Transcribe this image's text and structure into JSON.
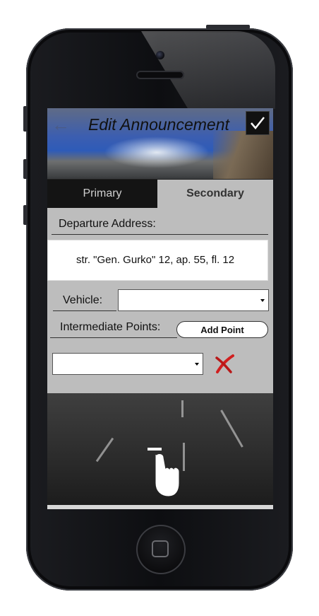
{
  "header": {
    "title": "Edit Announcement",
    "back_icon": "arrow-left-icon",
    "confirm_icon": "checkmark-icon"
  },
  "tabs": [
    {
      "label": "Primary",
      "active": false
    },
    {
      "label": "Secondary",
      "active": true
    }
  ],
  "form": {
    "departure_label": "Departure Address:",
    "departure_value": "str. \"Gen. Gurko\" 12, ap. 55, fl. 12",
    "vehicle_label": "Vehicle:",
    "vehicle_value": "",
    "intermediate_label": "Intermediate Points:",
    "add_point_label": "Add Point",
    "point_value": "",
    "delete_icon": "red-x-icon"
  },
  "colors": {
    "panel_bg": "#bdbdbd",
    "active_tab_bg": "#bdbdbd",
    "inactive_tab_bg": "#141414",
    "delete_red": "#d11f1f"
  },
  "gesture": {
    "icon": "hand-swipe-icon"
  }
}
